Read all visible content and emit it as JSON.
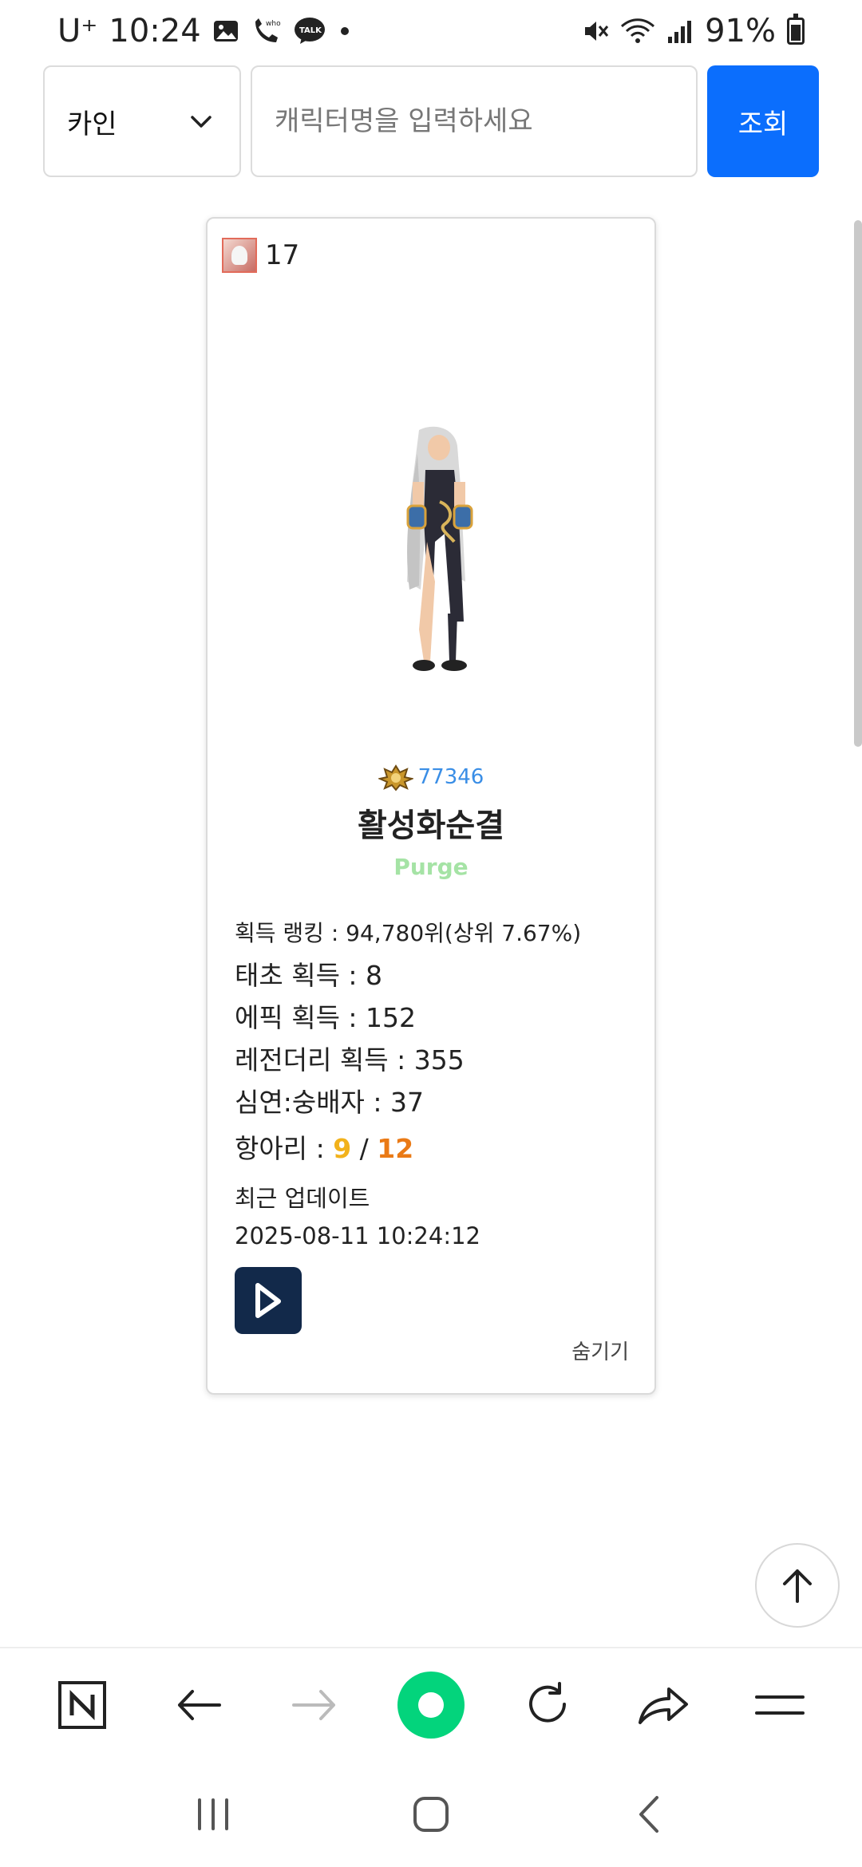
{
  "status_bar": {
    "carrier": "U⁺",
    "time": "10:24",
    "battery": "91%"
  },
  "search": {
    "server": "카인",
    "placeholder": "캐릭터명을 입력하세요",
    "button_label": "조회"
  },
  "card": {
    "class_level": "17",
    "fame": "77346",
    "name": "활성화순결",
    "guild": "Purge",
    "rank_text": "획득 랭킹 : 94,780위(상위 7.67%)",
    "taecho": "태초 획득 : 8",
    "epic": "에픽 획득 : 152",
    "legendary": "레전더리 획득 : 355",
    "abyss": "심연:숭배자 : 37",
    "pot_label": "항아리 : ",
    "pot_current": "9",
    "pot_sep": " / ",
    "pot_total": "12",
    "update_label": "최근 업데이트",
    "update_time": "2025-08-11 10:24:12",
    "hide_label": "숨기기"
  },
  "icons": {
    "status": [
      "gallery-icon",
      "call-icon",
      "talk-icon",
      "mute-icon",
      "wifi-icon",
      "signal-icon",
      "battery-icon"
    ],
    "toolbar": [
      "naver-icon",
      "back-arrow-icon",
      "forward-arrow-icon",
      "green-home-icon",
      "reload-icon",
      "share-icon",
      "menu-icon"
    ],
    "nav": [
      "recents-icon",
      "home-icon",
      "back-icon"
    ]
  },
  "colors": {
    "accent": "#0b6efd",
    "fame": "#3a8ee6",
    "guild": "#a5e3a5",
    "pot_current": "#f2b21b",
    "pot_total": "#ea7a16",
    "dundam": "#12294a",
    "naver_green": "#03d47c"
  }
}
